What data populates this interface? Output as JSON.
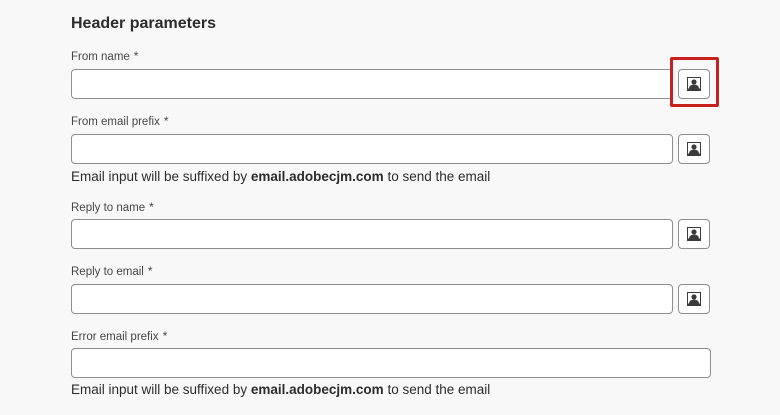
{
  "section": {
    "title": "Header parameters"
  },
  "required_marker": "*",
  "fields": [
    {
      "label": "From name",
      "value": ""
    },
    {
      "label": "From email prefix",
      "value": ""
    },
    {
      "label": "Reply to name",
      "value": ""
    },
    {
      "label": "Reply to email",
      "value": ""
    },
    {
      "label": "Error email prefix",
      "value": ""
    }
  ],
  "help": {
    "prefix": "Email input will be suffixed by",
    "domain": "email.adobecjm.com",
    "suffix": "to send the email"
  },
  "icons": {
    "personalization": "personalization-icon"
  },
  "colors": {
    "highlight": "#c8201e",
    "input_border": "#8e8e8e",
    "background": "#f8f8f8"
  }
}
